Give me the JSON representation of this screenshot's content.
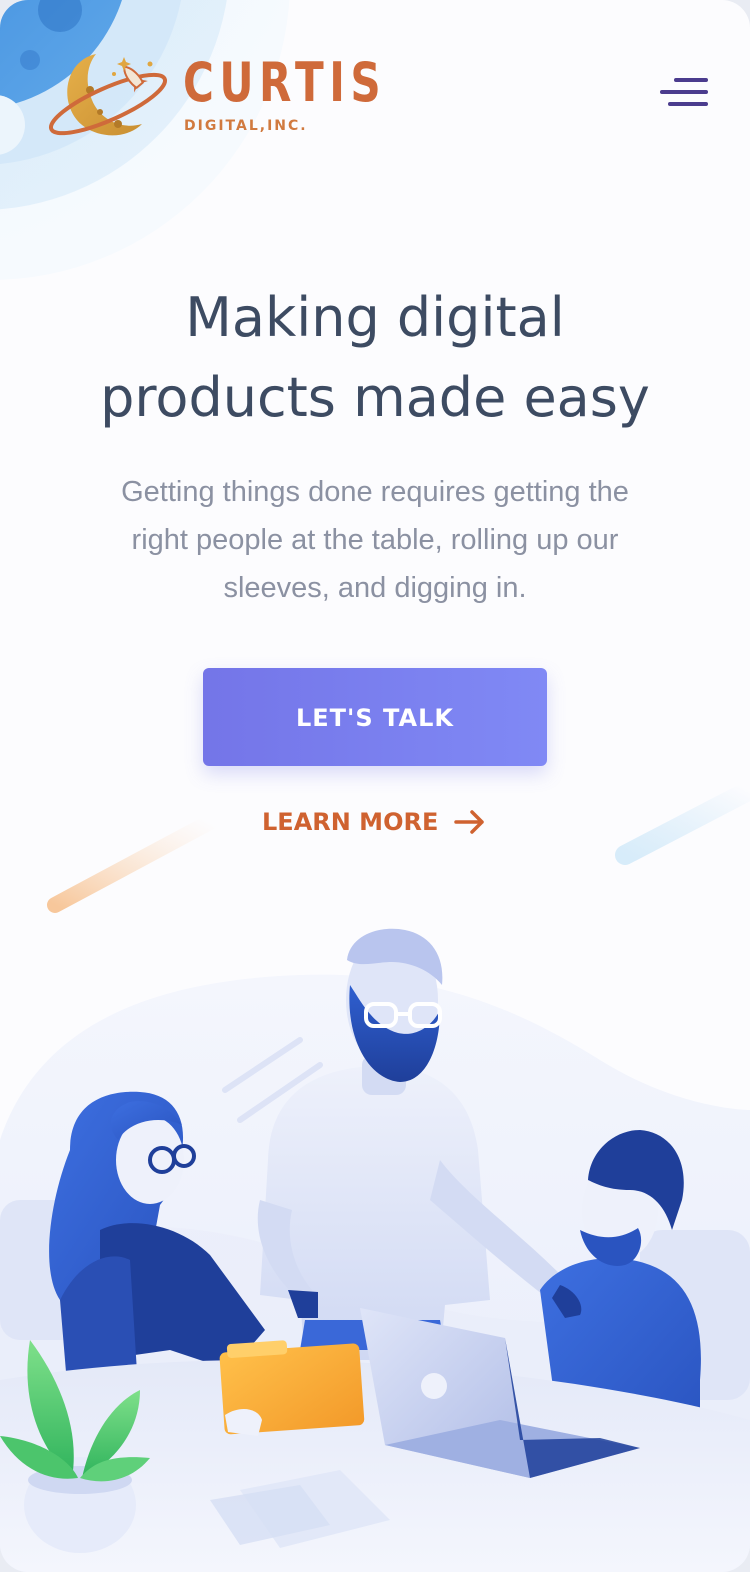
{
  "header": {
    "brand_name": "CURTIS",
    "brand_sub": "DIGITAL,INC."
  },
  "hero": {
    "title_lines": [
      "Making digital",
      "products made easy"
    ],
    "subtitle_lines": [
      "Getting things done requires getting the",
      "right people at the table, rolling up our",
      "sleeves, and digging in."
    ],
    "cta_label": "LET'S TALK",
    "learn_more_label": "LEARN MORE"
  },
  "colors": {
    "brand_orange": "#cf6a3a",
    "accent_purple": "#7b7ff0",
    "heading": "#3d4b62",
    "body_text": "#8b91a2",
    "menu_icon": "#4b3c8e"
  },
  "icons": {
    "logo": "moon-planet-rocket-logo",
    "menu": "hamburger-menu-icon",
    "learn_more": "arrow-right-icon"
  }
}
